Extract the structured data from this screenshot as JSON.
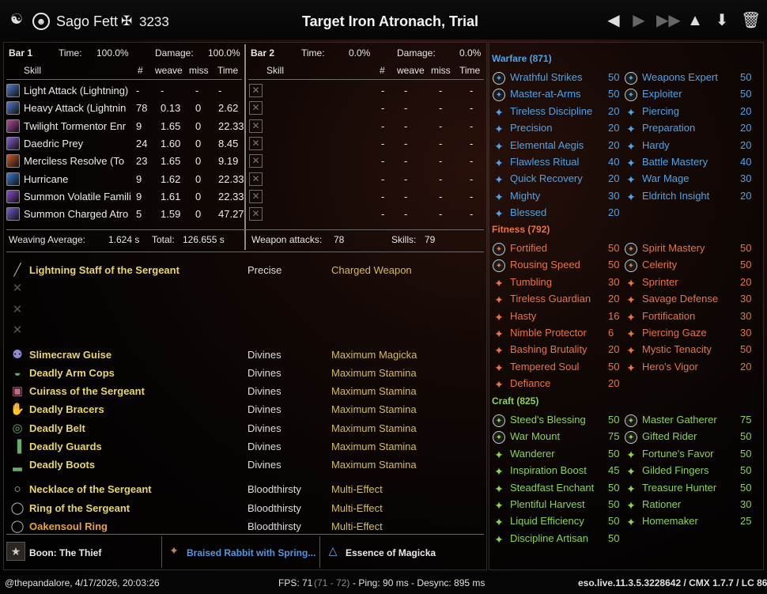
{
  "header": {
    "logo_icon": "eso-emblem-icon",
    "player_icon": "player-portrait-icon",
    "player_name": "Sago Fett",
    "cp_icon": "champion-point-icon",
    "cp_total": "3233",
    "fight_title": "Target Iron Atronach, Trial",
    "buttons": [
      "prev-fight",
      "next-fight",
      "last-fight",
      "upload",
      "save",
      "delete"
    ]
  },
  "bar1": {
    "title": "Bar 1",
    "time_label": "Time:",
    "time_value": "100.0%",
    "damage_label": "Damage:",
    "damage_value": "100.0%",
    "col_skill": "Skill",
    "col_num": "#",
    "col_weave": "weave",
    "col_miss": "miss",
    "col_time": "Time",
    "skills": [
      {
        "name": "Light Attack (Lightning)",
        "count": "-",
        "weave": "-",
        "miss": "-",
        "time": "-",
        "color": "#4f7bd1"
      },
      {
        "name": "Heavy Attack (Lightnin",
        "count": "78",
        "weave": "0.13",
        "miss": "0",
        "time": "2.62",
        "color": "#4f7bd1"
      },
      {
        "name": "Twilight Tormentor Enr",
        "count": "9",
        "weave": "1.65",
        "miss": "0",
        "time": "22.33",
        "color": "#b04aa0"
      },
      {
        "name": "Daedric Prey",
        "count": "24",
        "weave": "1.60",
        "miss": "0",
        "time": "8.45",
        "color": "#8a5fd0"
      },
      {
        "name": "Merciless Resolve (To",
        "count": "23",
        "weave": "1.65",
        "miss": "0",
        "time": "9.19",
        "color": "#c85a2a"
      },
      {
        "name": "Hurricane",
        "count": "9",
        "weave": "1.62",
        "miss": "0",
        "time": "22.33",
        "color": "#3a7ad8"
      },
      {
        "name": "Summon Volatile Famili",
        "count": "9",
        "weave": "1.61",
        "miss": "0",
        "time": "22.33",
        "color": "#8a4ad0"
      },
      {
        "name": "Summon Charged Atro",
        "count": "5",
        "weave": "1.59",
        "miss": "0",
        "time": "47.27",
        "color": "#7a5ad8"
      }
    ]
  },
  "bar2": {
    "title": "Bar 2",
    "time_label": "Time:",
    "time_value": "0.0%",
    "damage_label": "Damage:",
    "damage_value": "0.0%",
    "col_skill": "Skill",
    "col_num": "#",
    "col_weave": "weave",
    "col_miss": "miss",
    "col_time": "Time",
    "rows": 8,
    "dash": "-"
  },
  "summary": {
    "weaving_label": "Weaving Average:",
    "weaving_value": "1.624 s",
    "total_label": "Total:",
    "total_value": "126.655 s",
    "weapon_label": "Weapon attacks:",
    "weapon_value": "78",
    "skills_label": "Skills:",
    "skills_value": "79"
  },
  "gear": [
    {
      "icon": "staff-icon",
      "name": "Lightning Staff of the Sergeant",
      "trait": "Precise",
      "enchant": "Charged Weapon",
      "mythic": false
    },
    {
      "icon": "empty-weapon-slot-icon",
      "name": "",
      "trait": "",
      "enchant": "",
      "mythic": false
    },
    {
      "icon": "empty-weapon-slot-icon",
      "name": "",
      "trait": "",
      "enchant": "",
      "mythic": false
    },
    {
      "icon": "empty-weapon-slot-icon",
      "name": "",
      "trait": "",
      "enchant": "",
      "mythic": false
    },
    {
      "icon": "helmet-icon",
      "name": "Slimecraw Guise",
      "trait": "Divines",
      "enchant": "Maximum Magicka",
      "mythic": false
    },
    {
      "icon": "shoulder-icon",
      "name": "Deadly Arm Cops",
      "trait": "Divines",
      "enchant": "Maximum Stamina",
      "mythic": false
    },
    {
      "icon": "chest-icon",
      "name": "Cuirass of the Sergeant",
      "trait": "Divines",
      "enchant": "Maximum Stamina",
      "mythic": false
    },
    {
      "icon": "gloves-icon",
      "name": "Deadly Bracers",
      "trait": "Divines",
      "enchant": "Maximum Stamina",
      "mythic": false
    },
    {
      "icon": "belt-icon",
      "name": "Deadly Belt",
      "trait": "Divines",
      "enchant": "Maximum Stamina",
      "mythic": false
    },
    {
      "icon": "legs-icon",
      "name": "Deadly Guards",
      "trait": "Divines",
      "enchant": "Maximum Stamina",
      "mythic": false
    },
    {
      "icon": "boots-icon",
      "name": "Deadly Boots",
      "trait": "Divines",
      "enchant": "Maximum Stamina",
      "mythic": false
    },
    {
      "icon": "necklace-icon",
      "name": "Necklace of the Sergeant",
      "trait": "Bloodthirsty",
      "enchant": "Multi-Effect",
      "mythic": false
    },
    {
      "icon": "ring-icon",
      "name": "Ring of the Sergeant",
      "trait": "Bloodthirsty",
      "enchant": "Multi-Effect",
      "mythic": false
    },
    {
      "icon": "ring-icon",
      "name": "Oakensoul Ring",
      "trait": "Bloodthirsty",
      "enchant": "Multi-Effect",
      "mythic": true
    }
  ],
  "bottom": {
    "boon": "Boon: The Thief",
    "food": "Braised Rabbit with Spring...",
    "potion": "Essence of Magicka"
  },
  "cp": {
    "warfare": {
      "title": "Warfare (871)",
      "color": "#4fa3e6",
      "left": [
        {
          "name": "Wrathful Strikes",
          "points": "50",
          "slot": true
        },
        {
          "name": "Master-at-Arms",
          "points": "50",
          "slot": true
        },
        {
          "name": "Tireless Discipline",
          "points": "20",
          "slot": false
        },
        {
          "name": "Precision",
          "points": "20",
          "slot": false
        },
        {
          "name": "Elemental Aegis",
          "points": "20",
          "slot": false
        },
        {
          "name": "Flawless Ritual",
          "points": "40",
          "slot": false
        },
        {
          "name": "Quick Recovery",
          "points": "20",
          "slot": false
        },
        {
          "name": "Mighty",
          "points": "30",
          "slot": false
        },
        {
          "name": "Blessed",
          "points": "20",
          "slot": false
        }
      ],
      "right": [
        {
          "name": "Weapons Expert",
          "points": "50",
          "slot": true
        },
        {
          "name": "Exploiter",
          "points": "50",
          "slot": true
        },
        {
          "name": "Piercing",
          "points": "20",
          "slot": false
        },
        {
          "name": "Preparation",
          "points": "20",
          "slot": false
        },
        {
          "name": "Hardy",
          "points": "20",
          "slot": false
        },
        {
          "name": "Battle Mastery",
          "points": "40",
          "slot": false
        },
        {
          "name": "War Mage",
          "points": "30",
          "slot": false
        },
        {
          "name": "Eldritch Insight",
          "points": "20",
          "slot": false
        }
      ]
    },
    "fitness": {
      "title": "Fitness (792)",
      "color": "#e8743f",
      "left": [
        {
          "name": "Fortified",
          "points": "50",
          "slot": true
        },
        {
          "name": "Rousing Speed",
          "points": "50",
          "slot": true
        },
        {
          "name": "Tumbling",
          "points": "30",
          "slot": false
        },
        {
          "name": "Tireless Guardian",
          "points": "20",
          "slot": false
        },
        {
          "name": "Hasty",
          "points": "16",
          "slot": false
        },
        {
          "name": "Nimble Protector",
          "points": "6",
          "slot": false
        },
        {
          "name": "Bashing Brutality",
          "points": "20",
          "slot": false
        },
        {
          "name": "Tempered Soul",
          "points": "50",
          "slot": false
        },
        {
          "name": "Defiance",
          "points": "20",
          "slot": false
        }
      ],
      "right": [
        {
          "name": "Spirit Mastery",
          "points": "50",
          "slot": true
        },
        {
          "name": "Celerity",
          "points": "50",
          "slot": true
        },
        {
          "name": "Sprinter",
          "points": "20",
          "slot": false
        },
        {
          "name": "Savage Defense",
          "points": "30",
          "slot": false
        },
        {
          "name": "Fortification",
          "points": "30",
          "slot": false
        },
        {
          "name": "Piercing Gaze",
          "points": "30",
          "slot": false
        },
        {
          "name": "Mystic Tenacity",
          "points": "50",
          "slot": false
        },
        {
          "name": "Hero's Vigor",
          "points": "20",
          "slot": false
        }
      ]
    },
    "craft": {
      "title": "Craft (825)",
      "color": "#8bd34a",
      "left": [
        {
          "name": "Steed's Blessing",
          "points": "50",
          "slot": true
        },
        {
          "name": "War Mount",
          "points": "75",
          "slot": true
        },
        {
          "name": "Wanderer",
          "points": "50",
          "slot": false
        },
        {
          "name": "Inspiration Boost",
          "points": "45",
          "slot": false
        },
        {
          "name": "Steadfast Enchant",
          "points": "50",
          "slot": false
        },
        {
          "name": "Plentiful Harvest",
          "points": "50",
          "slot": false
        },
        {
          "name": "Liquid Efficiency",
          "points": "50",
          "slot": false
        },
        {
          "name": "Discipline Artisan",
          "points": "50",
          "slot": false
        }
      ],
      "right": [
        {
          "name": "Master Gatherer",
          "points": "75",
          "slot": true
        },
        {
          "name": "Gifted Rider",
          "points": "50",
          "slot": true
        },
        {
          "name": "Fortune's Favor",
          "points": "50",
          "slot": false
        },
        {
          "name": "Gilded Fingers",
          "points": "50",
          "slot": false
        },
        {
          "name": "Treasure Hunter",
          "points": "50",
          "slot": false
        },
        {
          "name": "Rationer",
          "points": "30",
          "slot": false
        },
        {
          "name": "Homemaker",
          "points": "25",
          "slot": false
        }
      ]
    }
  },
  "footer": {
    "left": "@thepandalore, 4/17/2026, 20:03:26",
    "fps_label": "FPS: 71",
    "fps_range": "(71 - 72)",
    "ping": "- Ping: 90 ms - Desync: 895 ms",
    "right": "eso.live.11.3.5.3228642 / CMX 1.7.7 / LC 86"
  }
}
